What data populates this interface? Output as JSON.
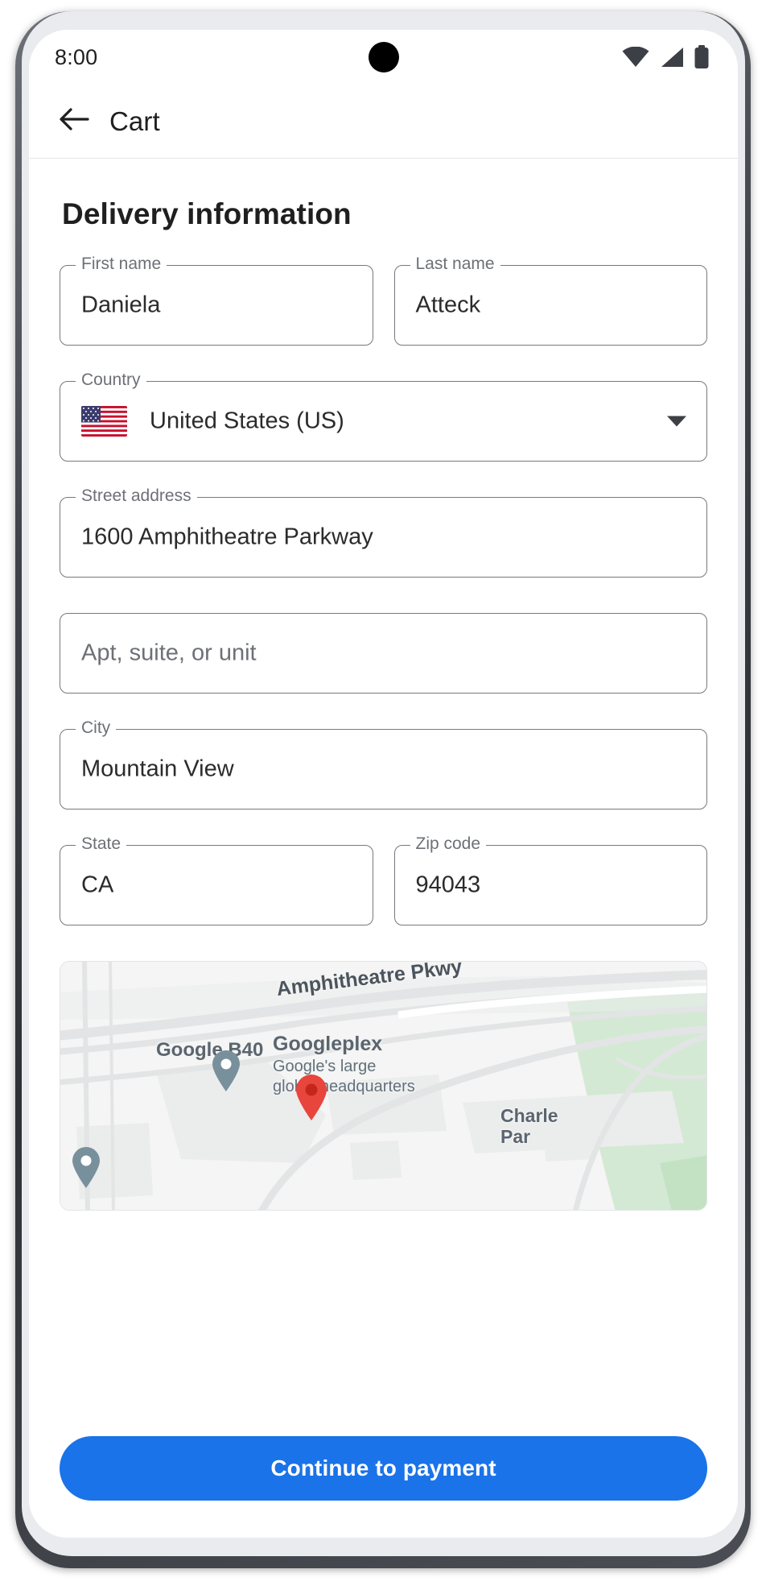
{
  "status_bar": {
    "time": "8:00",
    "icons": [
      "wifi-icon",
      "cell-signal-icon",
      "battery-icon"
    ]
  },
  "app_bar": {
    "back_icon": "arrow-back-icon",
    "title": "Cart"
  },
  "main": {
    "section_title": "Delivery information",
    "fields": [
      {
        "name": "first-name",
        "label": "First name",
        "value": "Daniela",
        "placeholder": ""
      },
      {
        "name": "last-name",
        "label": "Last name",
        "value": "Atteck",
        "placeholder": ""
      },
      {
        "name": "country",
        "label": "Country",
        "value": "United States (US)",
        "placeholder": "",
        "flag": "us-flag-icon",
        "dropdown": true
      },
      {
        "name": "street-address",
        "label": "Street address",
        "value": "1600 Amphitheatre Parkway",
        "placeholder": ""
      },
      {
        "name": "apt-suite-unit",
        "label": "",
        "value": "",
        "placeholder": "Apt, suite, or unit"
      },
      {
        "name": "city",
        "label": "City",
        "value": "Mountain View",
        "placeholder": ""
      },
      {
        "name": "state",
        "label": "State",
        "value": "CA",
        "placeholder": ""
      },
      {
        "name": "zip-code",
        "label": "Zip code",
        "value": "94043",
        "placeholder": ""
      }
    ],
    "map": {
      "street_label": "Amphitheatre Pkwy",
      "poi_b40": "Google B40",
      "poi_googleplex": "Googleplex",
      "poi_googleplex_sub_1": "Google's large",
      "poi_googleplex_sub_2": "global headquarters",
      "poi_charleston_1": "Charle",
      "poi_charleston_2": "Par",
      "marker_primary_color": "#e8453c",
      "marker_secondary_color": "#78909c"
    }
  },
  "bottom_bar": {
    "cta_label": "Continue to payment",
    "cta_color": "#1a73e8"
  }
}
